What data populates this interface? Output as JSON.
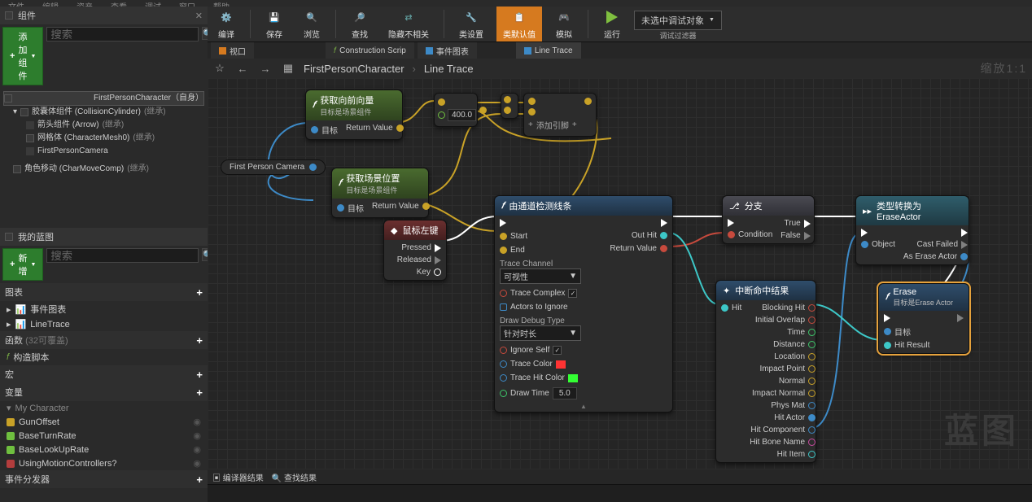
{
  "menu": {
    "items": [
      "文件",
      "编辑",
      "资产",
      "查看",
      "调试",
      "窗口",
      "帮助"
    ]
  },
  "components": {
    "panel_title": "组件",
    "add_btn": "添加组件",
    "search_placeholder": "搜索",
    "root_label": "FirstPersonCharacter（自身）",
    "tree": [
      {
        "label": "胶囊体组件 (CollisionCylinder)",
        "inh": "(继承)",
        "indent": 1
      },
      {
        "label": "箭头组件 (Arrow)",
        "inh": "(继承)",
        "indent": 2
      },
      {
        "label": "网格体 (CharacterMesh0)",
        "inh": "(继承)",
        "indent": 2
      },
      {
        "label": "FirstPersonCamera",
        "inh": "",
        "indent": 2
      },
      {
        "label": "角色移动 (CharMoveComp)",
        "inh": "(继承)",
        "indent": 1
      }
    ]
  },
  "myblueprint": {
    "panel_title": "我的蓝图",
    "new_btn": "新增",
    "search_placeholder": "搜索",
    "sections": {
      "graph": {
        "title": "图表",
        "items": [
          "事件图表",
          "LineTrace"
        ]
      },
      "func": {
        "title": "函数",
        "suffix": "(32可覆盖)",
        "items": [
          "构造脚本"
        ]
      },
      "macro": {
        "title": "宏",
        "items": []
      },
      "vars": {
        "title": "变量",
        "category": "My Character",
        "items": [
          {
            "name": "GunOffset",
            "color": "#c9a227"
          },
          {
            "name": "BaseTurnRate",
            "color": "#6fbf3f"
          },
          {
            "name": "BaseLookUpRate",
            "color": "#6fbf3f"
          },
          {
            "name": "UsingMotionControllers?",
            "color": "#b33d3d"
          }
        ]
      },
      "disp": {
        "title": "事件分发器"
      }
    }
  },
  "toolbar": {
    "buttons": [
      {
        "name": "compile",
        "label": "编译",
        "icon": "⚙"
      },
      {
        "name": "save",
        "label": "保存",
        "icon": "▣"
      },
      {
        "name": "browse",
        "label": "浏览",
        "icon": "🔍"
      },
      {
        "name": "find",
        "label": "查找",
        "icon": "🔍"
      },
      {
        "name": "hide-unrelated",
        "label": "隐藏不相关",
        "icon": "⇄"
      },
      {
        "name": "class-settings",
        "label": "类设置",
        "icon": "✦"
      },
      {
        "name": "class-defaults",
        "label": "类默认值",
        "icon": "≣"
      },
      {
        "name": "simulate",
        "label": "模拟",
        "icon": "◧"
      },
      {
        "name": "play",
        "label": "运行",
        "icon": "▶"
      }
    ],
    "debug_combo": "未选中调试对象",
    "debug_filter": "调试过滤器"
  },
  "graph_tabs": {
    "t1": "视口",
    "t2": "Construction Scrip",
    "t3": "事件图表",
    "t4": "Line Trace"
  },
  "breadcrumb": {
    "root": "FirstPersonCharacter",
    "leaf": "Line Trace",
    "zoom": "缩放1:1"
  },
  "nodes": {
    "getFwd": {
      "title": "获取向前向量",
      "sub": "目标是场景组件",
      "in_target": "目标",
      "out": "Return Value"
    },
    "getLoc": {
      "title": "获取场景位置",
      "sub": "目标是场景组件",
      "in_target": "目标",
      "out": "Return Value"
    },
    "camVar": "First Person Camera",
    "mult": {
      "value": "400.0"
    },
    "add": "添加引脚",
    "mouse": {
      "title": "鼠标左键",
      "p": "Pressed",
      "r": "Released",
      "k": "Key"
    },
    "trace": {
      "title": "由通道检测线条",
      "start": "Start",
      "end": "End",
      "out_hit": "Out Hit",
      "retval": "Return Value",
      "trace_channel_lbl": "Trace Channel",
      "trace_channel_val": "可视性",
      "trace_complex": "Trace Complex",
      "actors_ignore": "Actors to Ignore",
      "draw_type_lbl": "Draw Debug Type",
      "draw_type_val": "针对时长",
      "ignore_self": "Ignore Self",
      "trace_color": "Trace Color",
      "trace_hit_color": "Trace Hit Color",
      "draw_time": "Draw Time",
      "draw_time_val": "5.0"
    },
    "branch": {
      "title": "分支",
      "cond": "Condition",
      "true": "True",
      "false": "False"
    },
    "breakhit": {
      "title": "中断命中结果",
      "hit": "Hit",
      "outs": [
        "Blocking Hit",
        "Initial Overlap",
        "Time",
        "Distance",
        "Location",
        "Impact Point",
        "Normal",
        "Impact Normal",
        "Phys Mat",
        "Hit Actor",
        "Hit Component",
        "Hit Bone Name",
        "Hit Item"
      ]
    },
    "cast": {
      "title": "类型转换为 EraseActor",
      "obj": "Object",
      "fail": "Cast Failed",
      "as": "As Erase Actor"
    },
    "erase": {
      "title": "Erase",
      "sub": "目标是Erase Actor",
      "target": "目标",
      "hitres": "Hit Result"
    }
  },
  "bottom_tabs": {
    "a": "编译器结果",
    "b": "查找结果"
  },
  "watermark": "蓝图"
}
